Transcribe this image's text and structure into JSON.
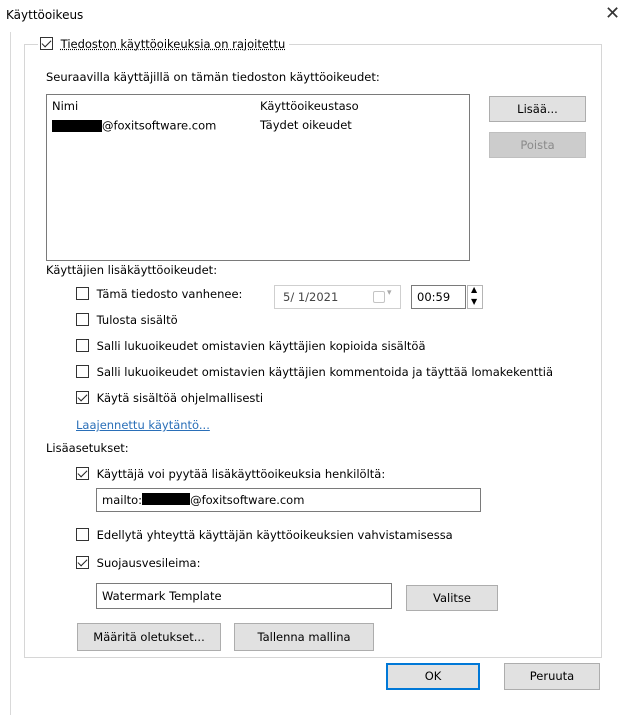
{
  "window": {
    "title": "Käyttöoikeus",
    "close_glyph": "✕"
  },
  "restrict": {
    "label": "Tiedoston käyttöoikeuksia on rajoitettu",
    "checked": true
  },
  "users": {
    "heading": "Seuraavilla käyttäjillä on tämän tiedoston käyttöoikeudet:",
    "columns": [
      "Nimi",
      "Käyttöoikeustaso"
    ],
    "rows": [
      {
        "email_suffix": "@foxitsoftware.com",
        "level": "Täydet oikeudet"
      }
    ],
    "add_label": "Lisää...",
    "remove_label": "Poista"
  },
  "extra_rights": {
    "heading": "Käyttäjien lisäkäyttöoikeudet:",
    "expires": {
      "label": "Tämä tiedosto vanhenee:",
      "checked": false,
      "date": "5/  1/2021",
      "time": "00:59"
    },
    "print": {
      "label": "Tulosta sisältö",
      "checked": false
    },
    "copy": {
      "label": "Salli lukuoikeudet omistavien käyttäjien kopioida sisältöä",
      "checked": false
    },
    "comment": {
      "label": "Salli lukuoikeudet omistavien käyttäjien kommentoida ja täyttää lomakekenttiä",
      "checked": false
    },
    "programmatic": {
      "label": "Käytä sisältöä ohjelmallisesti",
      "checked": true
    },
    "extended_link": "Laajennettu käytäntö..."
  },
  "additional": {
    "heading": "Lisäasetukset:",
    "request": {
      "label": "Käyttäjä voi pyytää lisäkäyttöoikeuksia henkilöltä:",
      "checked": true,
      "mailto_prefix": "mailto:",
      "mailto_suffix": "@foxitsoftware.com"
    },
    "verify": {
      "label": "Edellytä yhteyttä käyttäjän käyttöoikeuksien vahvistamisessa",
      "checked": false
    },
    "watermark": {
      "label": "Suojausvesileima:",
      "checked": true,
      "value": "Watermark Template",
      "choose_label": "Valitse"
    },
    "set_defaults_label": "Määritä oletukset...",
    "save_template_label": "Tallenna mallina"
  },
  "footer": {
    "ok_label": "OK",
    "cancel_label": "Peruuta"
  }
}
